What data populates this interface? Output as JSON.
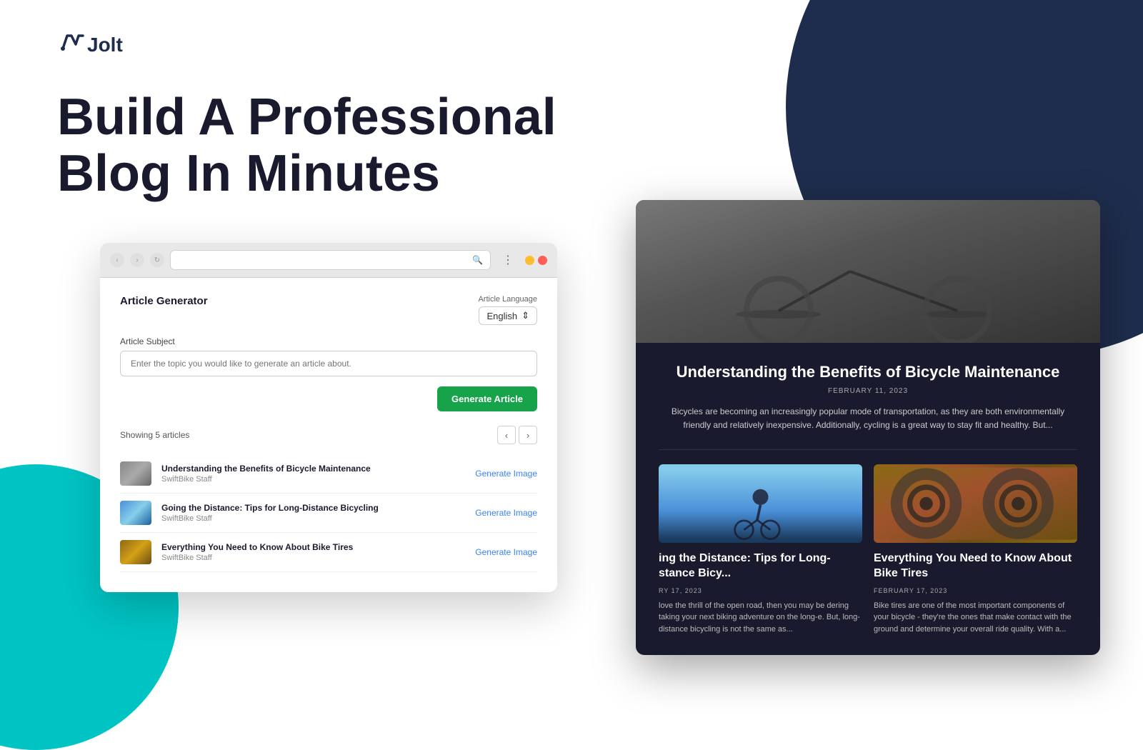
{
  "brand": {
    "logo_icon": "J",
    "logo_text": "Jolt"
  },
  "hero": {
    "headline_line1": "Build A Professional",
    "headline_line2": "Blog In Minutes"
  },
  "browser": {
    "address_placeholder": "",
    "article_generator_title": "Article Generator",
    "article_language_label": "Article Language",
    "language_value": "English",
    "article_subject_label": "Article Subject",
    "article_subject_placeholder": "Enter the topic you would like to generate an article about.",
    "generate_btn": "Generate Article",
    "showing_articles": "Showing 5 articles",
    "articles": [
      {
        "title": "Understanding the Benefits of Bicycle Maintenance",
        "author": "SwiftBike Staff",
        "generate_image": "Generate Image"
      },
      {
        "title": "Going the Distance: Tips for Long-Distance Bicycling",
        "author": "SwiftBike Staff",
        "generate_image": "Generate Image"
      },
      {
        "title": "Everything You Need to Know About Bike Tires",
        "author": "SwiftBike Staff",
        "generate_image": "Generate Image"
      }
    ]
  },
  "blog_preview": {
    "hero_post": {
      "title": "Understanding the Benefits of Bicycle Maintenance",
      "date": "FEBRUARY 11, 2023",
      "excerpt": "Bicycles are becoming an increasingly popular mode of transportation, as they are both environmentally friendly and relatively inexpensive. Additionally, cycling is a great way to stay fit and healthy. But..."
    },
    "left_card": {
      "title": "ing the Distance: Tips for Long-stance Bicy...",
      "date": "RY 17, 2023",
      "excerpt": "love the thrill of the open road, then you may be dering taking your next biking adventure on the long-e. But, long-distance bicycling is not the same as..."
    },
    "right_card": {
      "title": "Everything You Need to Know About Bike Tires",
      "date": "FEBRUARY 17, 2023",
      "excerpt": "Bike tires are one of the most important components of your bicycle - they're the ones that make contact with the ground and determine your overall ride quality. With a..."
    }
  }
}
